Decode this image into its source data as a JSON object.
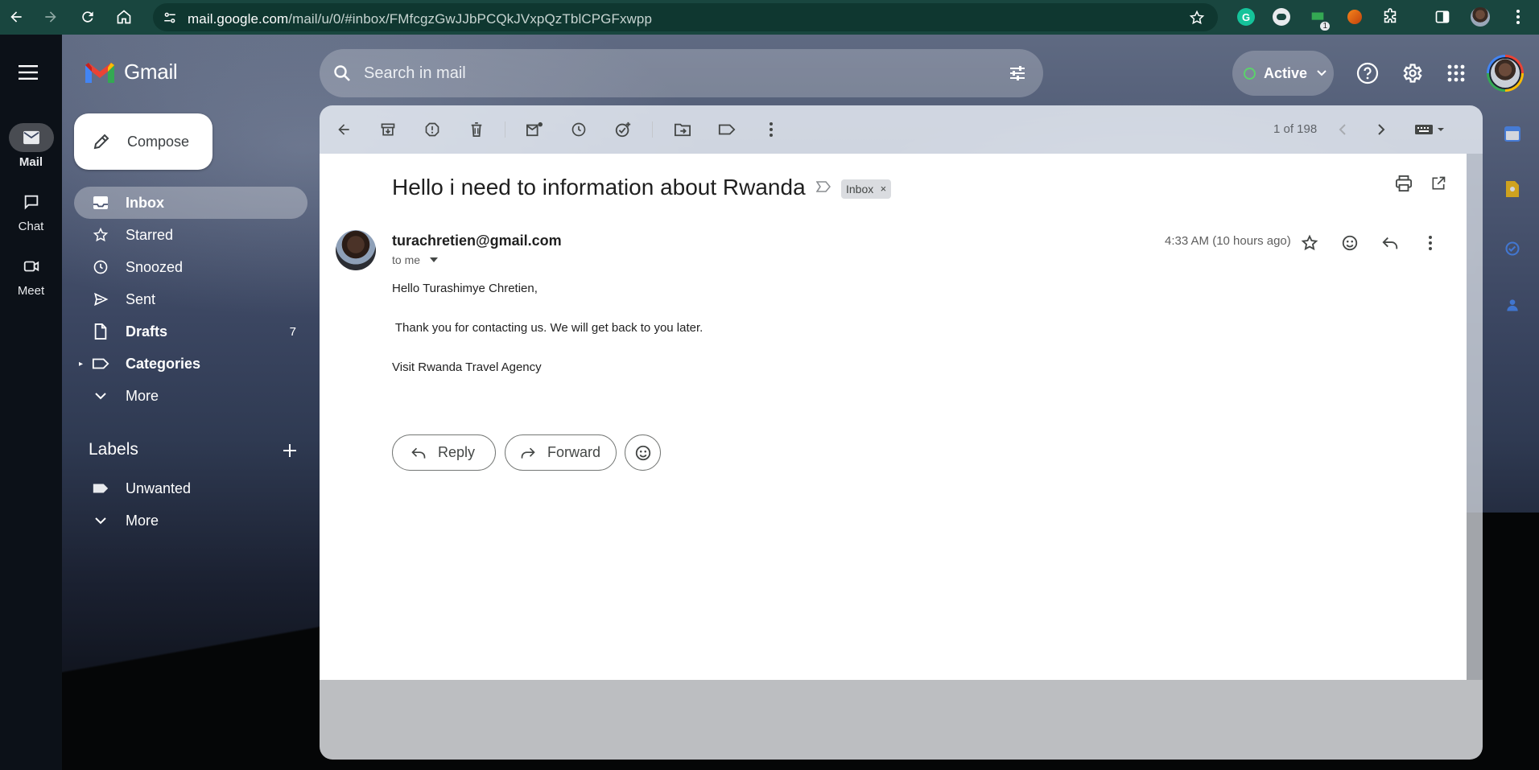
{
  "browser": {
    "url_host": "mail.google.com",
    "url_path": "/mail/u/0/#inbox/FMfcgzGwJJbPCQkJVxpQzTblCPGFxwpp",
    "extension_badge": "1"
  },
  "app": {
    "name": "Gmail",
    "search_placeholder": "Search in mail",
    "status": "Active"
  },
  "rail": [
    {
      "label": "Mail",
      "icon": "mail-icon"
    },
    {
      "label": "Chat",
      "icon": "chat-icon"
    },
    {
      "label": "Meet",
      "icon": "meet-icon"
    }
  ],
  "sidebar": {
    "compose_label": "Compose",
    "items": [
      {
        "label": "Inbox",
        "icon": "inbox-icon"
      },
      {
        "label": "Starred",
        "icon": "star-icon"
      },
      {
        "label": "Snoozed",
        "icon": "clock-icon"
      },
      {
        "label": "Sent",
        "icon": "send-icon"
      },
      {
        "label": "Drafts",
        "icon": "draft-icon",
        "count": "7"
      },
      {
        "label": "Categories",
        "icon": "label-icon"
      },
      {
        "label": "More",
        "icon": "chevron-down-icon"
      }
    ],
    "labels_heading": "Labels",
    "labels": [
      {
        "label": "Unwanted",
        "icon": "label-icon"
      },
      {
        "label": "More",
        "icon": "chevron-down-icon"
      }
    ]
  },
  "toolbar": {
    "pager": "1 of 198"
  },
  "message": {
    "subject": "Hello i need to information about Rwanda",
    "chip": "Inbox",
    "chip_close": "×",
    "sender": "turachretien@gmail.com",
    "recipient": "to me",
    "timestamp": "4:33 AM (10 hours ago)",
    "body": [
      "Hello Turashimye Chretien,",
      " Thank you for contacting us. We will get back to you later.",
      "Visit Rwanda Travel Agency"
    ],
    "reply_label": "Reply",
    "forward_label": "Forward"
  },
  "colors": {
    "chrome_bar": "#19463f",
    "accent_green": "#5bd26b",
    "gmail_red": "#ea4335",
    "gmail_blue": "#4285f4",
    "gmail_yellow": "#fbbc04",
    "gmail_green": "#34a853"
  }
}
